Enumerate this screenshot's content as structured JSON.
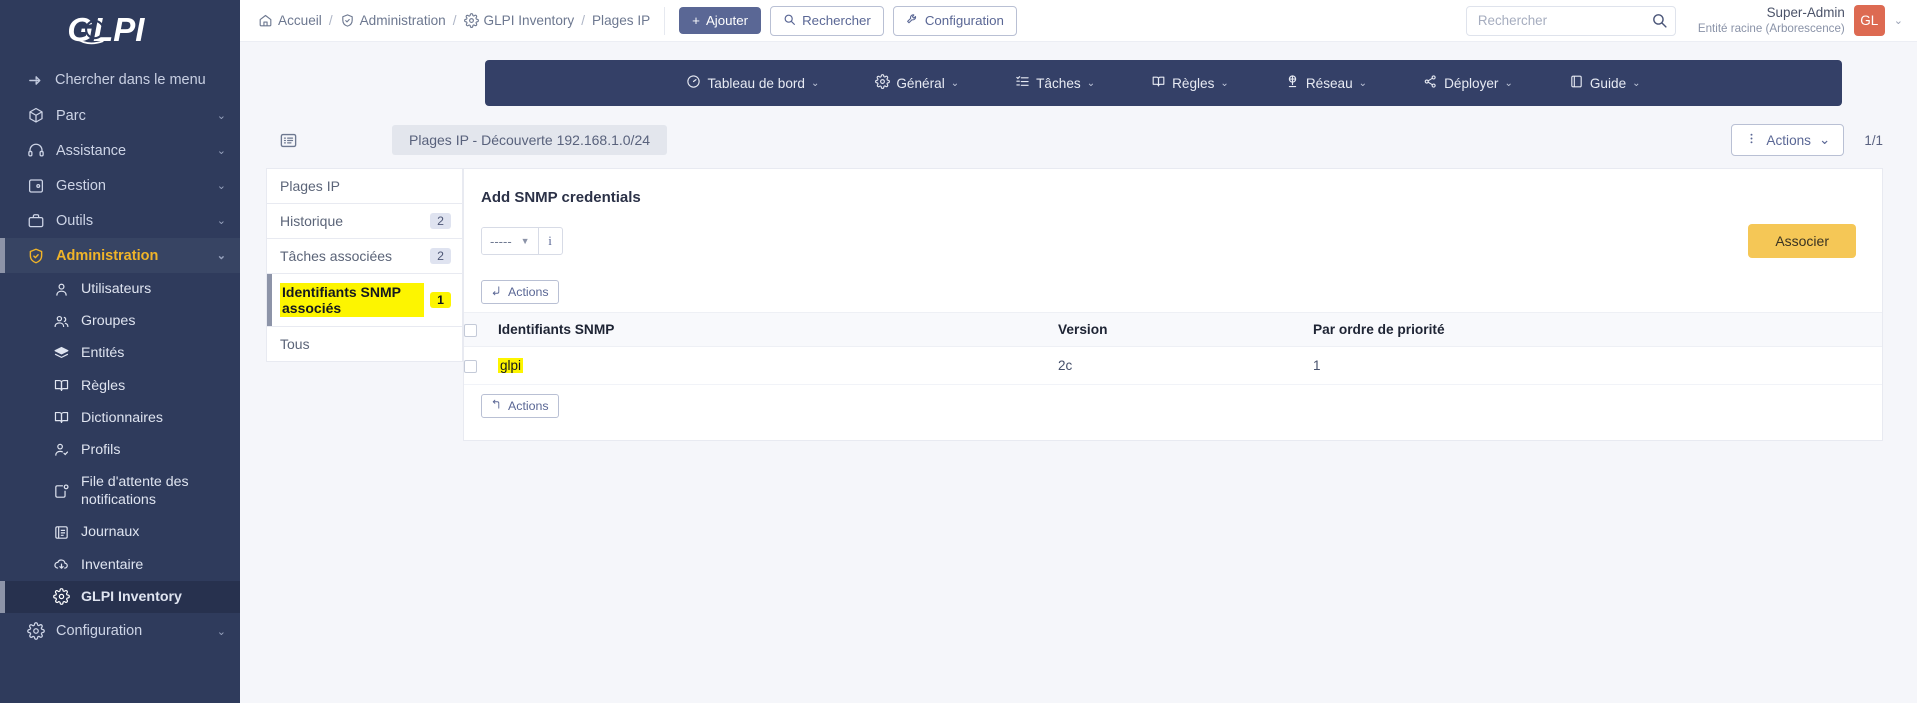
{
  "sidebar": {
    "logo_alt": "GLPI",
    "search_label": "Chercher dans le menu",
    "items": [
      {
        "label": "Parc",
        "icon": "box-icon",
        "caret": "⌄"
      },
      {
        "label": "Assistance",
        "icon": "headset-icon",
        "caret": "⌄"
      },
      {
        "label": "Gestion",
        "icon": "wallet-icon",
        "caret": "⌄"
      },
      {
        "label": "Outils",
        "icon": "briefcase-icon",
        "caret": "⌄"
      },
      {
        "label": "Administration",
        "icon": "shield-icon",
        "caret": "⌄",
        "active": true
      }
    ],
    "sub_items": [
      {
        "label": "Utilisateurs",
        "icon": "user-icon"
      },
      {
        "label": "Groupes",
        "icon": "users-icon"
      },
      {
        "label": "Entités",
        "icon": "layers-icon"
      },
      {
        "label": "Règles",
        "icon": "book-icon"
      },
      {
        "label": "Dictionnaires",
        "icon": "book-icon"
      },
      {
        "label": "Profils",
        "icon": "user-check-icon"
      },
      {
        "label": "File d'attente des notifications",
        "icon": "notification-icon"
      },
      {
        "label": "Journaux",
        "icon": "journal-icon"
      },
      {
        "label": "Inventaire",
        "icon": "cloud-download-icon"
      },
      {
        "label": "GLPI Inventory",
        "icon": "gear-icon",
        "current": true
      }
    ],
    "bottom_item": {
      "label": "Configuration",
      "icon": "gear-icon",
      "caret": "⌄"
    }
  },
  "topbar": {
    "breadcrumbs": [
      {
        "label": "Accueil",
        "icon": "home-icon"
      },
      {
        "label": "Administration",
        "icon": "shield-icon"
      },
      {
        "label": "GLPI Inventory",
        "icon": "gear-icon"
      },
      {
        "label": "Plages IP",
        "icon": ""
      }
    ],
    "separator": "/",
    "add_button": "Ajouter",
    "search_button": "Rechercher",
    "config_button": "Configuration",
    "search_placeholder": "Rechercher",
    "user_name": "Super-Admin",
    "user_entity": "Entité racine (Arborescence)",
    "avatar_initials": "GL",
    "user_caret": "⌄"
  },
  "navbar": {
    "items": [
      {
        "label": "Tableau de bord",
        "icon": "dashboard-icon",
        "caret": "⌄"
      },
      {
        "label": "Général",
        "icon": "gear-icon",
        "caret": "⌄"
      },
      {
        "label": "Tâches",
        "icon": "tasklist-icon",
        "caret": "⌄"
      },
      {
        "label": "Règles",
        "icon": "book-icon",
        "caret": "⌄"
      },
      {
        "label": "Réseau",
        "icon": "network-icon",
        "caret": "⌄"
      },
      {
        "label": "Déployer",
        "icon": "share-icon",
        "caret": "⌄"
      },
      {
        "label": "Guide",
        "icon": "guide-icon",
        "caret": "⌄"
      }
    ]
  },
  "content_header": {
    "list_icon": "list-view-icon",
    "title": "Plages IP - Découverte 192.168.1.0/24",
    "actions_button": "Actions",
    "actions_caret": "⌄",
    "pager": "1/1"
  },
  "tabs": [
    {
      "label": "Plages IP",
      "badge": ""
    },
    {
      "label": "Historique",
      "badge": "2"
    },
    {
      "label": "Tâches associées",
      "badge": "2"
    },
    {
      "label": "Identifiants SNMP associés",
      "badge": "1",
      "selected": true
    },
    {
      "label": "Tous",
      "badge": ""
    }
  ],
  "panel": {
    "title": "Add SNMP credentials",
    "select_value": "-----",
    "select_caret": "▼",
    "info_icon": "i",
    "associate_button": "Associer",
    "actions_top": "Actions",
    "actions_bottom": "Actions",
    "table": {
      "columns": [
        "Identifiants SNMP",
        "Version",
        "Par ordre de priorité"
      ],
      "rows": [
        {
          "name": "glpi",
          "version": "2c",
          "priority": "1",
          "highlight": true
        }
      ]
    }
  },
  "colors": {
    "sidebar_bg": "#2f3b5c",
    "accent_yellow": "#f0b429",
    "navbar_blue": "#344067",
    "associate_btn": "#f5c756",
    "avatar_red": "#dd6a52",
    "highlight": "#fdf500"
  }
}
